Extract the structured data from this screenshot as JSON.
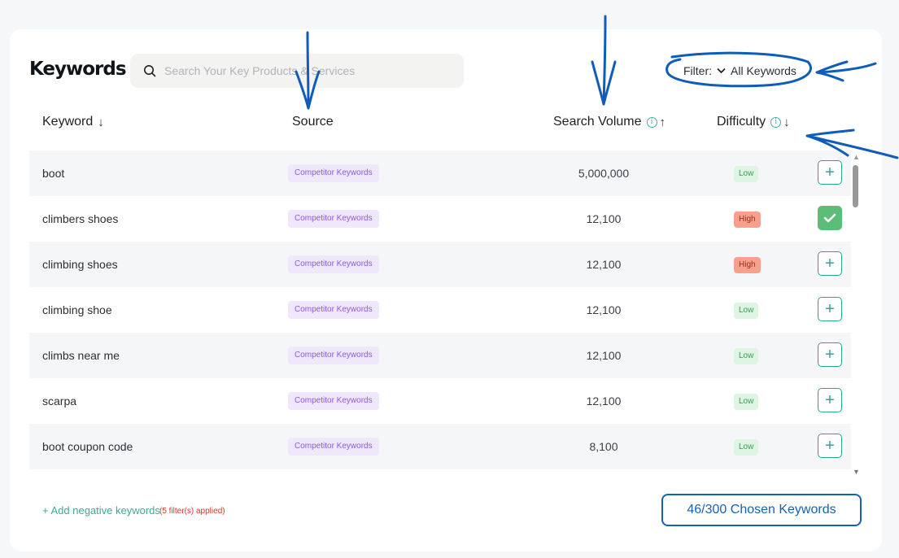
{
  "header": {
    "title": "Keywords",
    "search_placeholder": "Search Your Key Products & Services",
    "filter_label": "Filter:",
    "filter_value": "All Keywords"
  },
  "table": {
    "columns": {
      "keyword": "Keyword",
      "keyword_sort": "↓",
      "source": "Source",
      "volume": "Search Volume",
      "volume_sort": "↑",
      "difficulty": "Difficulty",
      "difficulty_sort": "↓"
    },
    "rows": [
      {
        "keyword": "boot",
        "source": "Competitor Keywords",
        "volume": "5,000,000",
        "difficulty": "Low",
        "selected": false
      },
      {
        "keyword": "climbers shoes",
        "source": "Competitor Keywords",
        "volume": "12,100",
        "difficulty": "High",
        "selected": true
      },
      {
        "keyword": "climbing shoes",
        "source": "Competitor Keywords",
        "volume": "12,100",
        "difficulty": "High",
        "selected": false
      },
      {
        "keyword": "climbing shoe",
        "source": "Competitor Keywords",
        "volume": "12,100",
        "difficulty": "Low",
        "selected": false
      },
      {
        "keyword": "climbs near me",
        "source": "Competitor Keywords",
        "volume": "12,100",
        "difficulty": "Low",
        "selected": false
      },
      {
        "keyword": "scarpa",
        "source": "Competitor Keywords",
        "volume": "12,100",
        "difficulty": "Low",
        "selected": false
      },
      {
        "keyword": "boot coupon code",
        "source": "Competitor Keywords",
        "volume": "8,100",
        "difficulty": "Low",
        "selected": false
      }
    ]
  },
  "footer": {
    "add_negative": "+ Add negative keywords",
    "filters_note": "(5 filter(s) applied)",
    "chosen_button": "46/300 Chosen Keywords"
  },
  "colors": {
    "accent_teal": "#2aa597",
    "annotation_blue": "#1462b5",
    "low_badge": "#ddf5e2",
    "high_badge": "#f7a08b",
    "source_badge": "#efe7fb"
  }
}
